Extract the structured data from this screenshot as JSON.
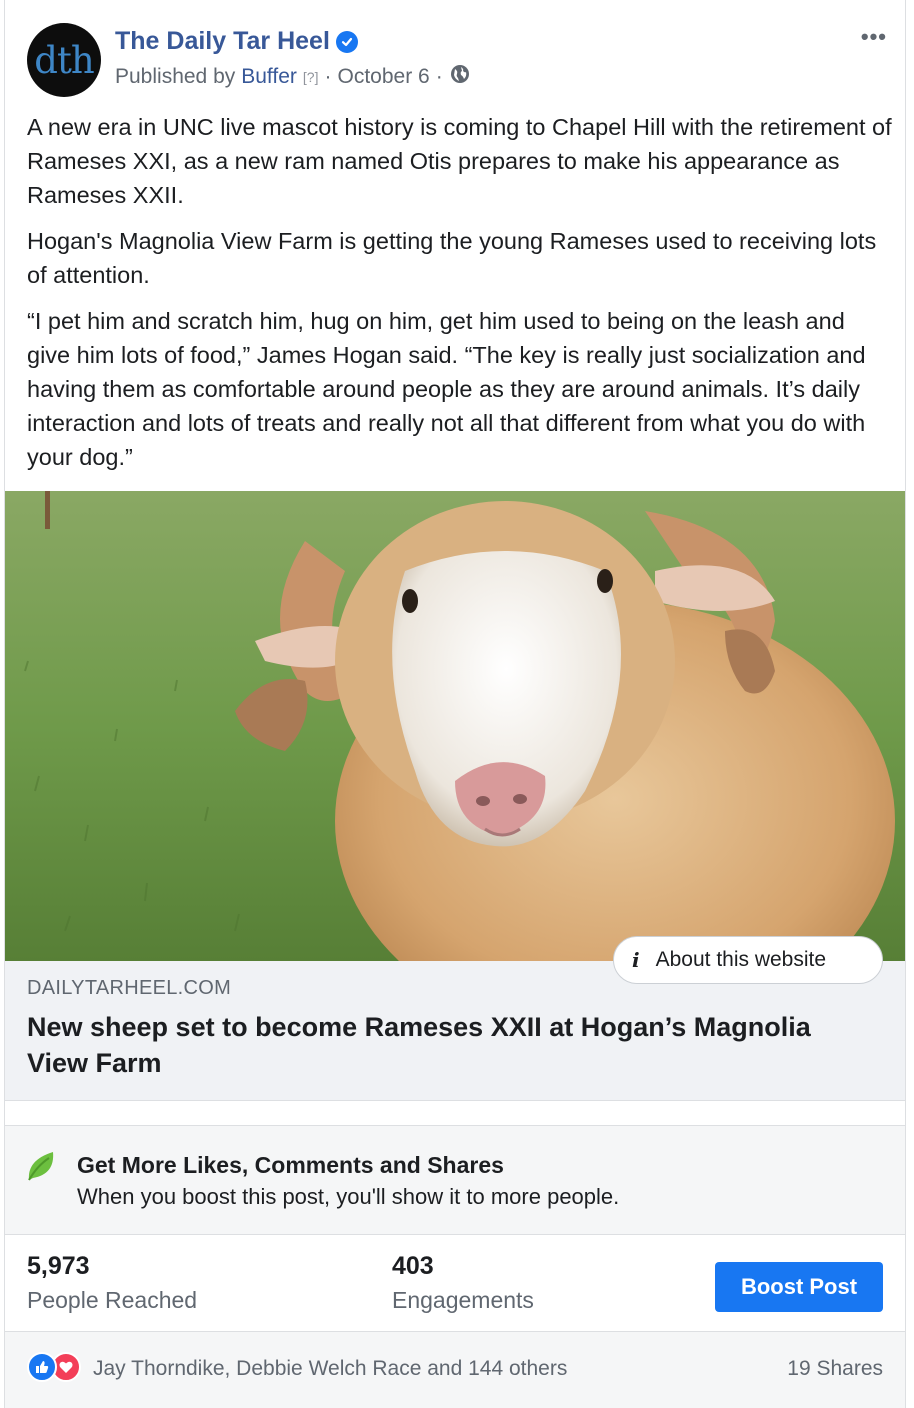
{
  "header": {
    "avatar_text": "dth",
    "page_name": "The Daily Tar Heel",
    "published_by_prefix": "Published by",
    "publisher": "Buffer",
    "help_marker": "[?]",
    "date": "October 6",
    "separator": "·",
    "more_label": "•••"
  },
  "post": {
    "paragraphs": [
      "A new era in UNC live mascot history is coming to Chapel Hill with the retirement of Rameses XXI, as a new ram named Otis prepares to make his appearance as Rameses XXII.",
      "Hogan's Magnolia View Farm is getting the young Rameses used to receiving lots of attention.",
      "“I pet him and scratch him, hug on him, get him used to being on the leash and give him lots of food,” James Hogan said. “The key is really just socialization and having them as comfortable around people as they are around animals. It’s daily interaction and lots of treats and really not all that different from what you do with your dog.”"
    ]
  },
  "link_preview": {
    "about_label": "About this website",
    "domain": "DAILYTARHEEL.COM",
    "headline": "New sheep set to become Rameses XXII at Hogan’s Magnolia View Farm"
  },
  "boost": {
    "title": "Get More Likes, Comments and Shares",
    "subtitle": "When you boost this post, you'll show it to more people."
  },
  "stats": {
    "reached_value": "5,973",
    "reached_label": "People Reached",
    "engagements_value": "403",
    "engagements_label": "Engagements",
    "boost_button": "Boost Post"
  },
  "reactions": {
    "names": "Jay Thorndike, Debbie Welch Race and 144 others",
    "shares": "19 Shares"
  },
  "colors": {
    "link_blue": "#385898",
    "boost_blue": "#1877f2",
    "love_red": "#f33e58",
    "leaf_green": "#6cbf3f"
  }
}
